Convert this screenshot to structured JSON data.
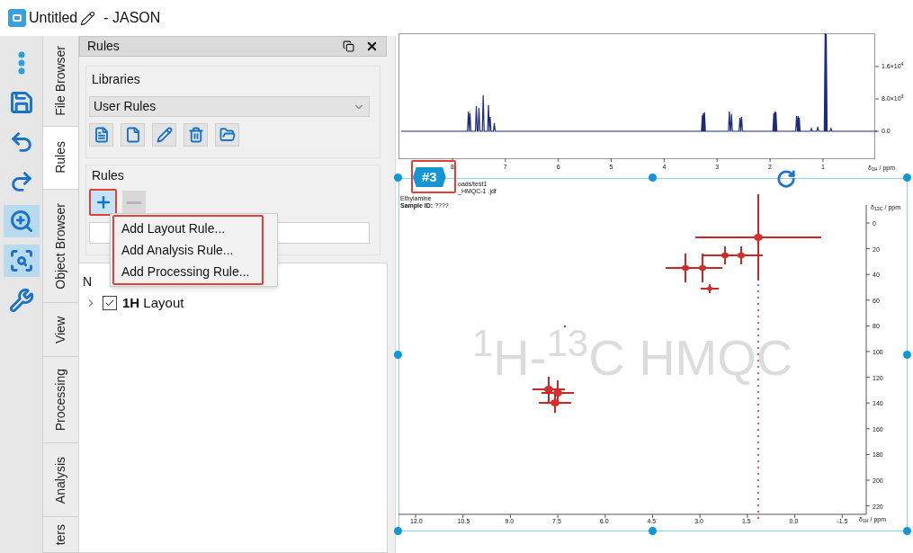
{
  "window": {
    "title": "Untitled",
    "app": "- JASON"
  },
  "toolbar": [
    {
      "kind": "more",
      "selected": false
    },
    {
      "kind": "save",
      "selected": false
    },
    {
      "kind": "undo",
      "selected": false
    },
    {
      "kind": "redo",
      "selected": false
    },
    {
      "kind": "zoom",
      "selected": true
    },
    {
      "kind": "zoom-region",
      "selected": true
    },
    {
      "kind": "tools",
      "selected": false
    }
  ],
  "side_tabs": [
    {
      "label": "File Browser",
      "selected": false
    },
    {
      "label": "Rules",
      "selected": true
    },
    {
      "label": "Object Browser",
      "selected": false
    },
    {
      "label": "View",
      "selected": false
    },
    {
      "label": "Processing",
      "selected": false
    },
    {
      "label": "Analysis",
      "selected": false
    },
    {
      "label": "ters",
      "selected": false
    }
  ],
  "panel": {
    "title": "Rules",
    "libraries": {
      "label": "Libraries",
      "value": "User Rules"
    },
    "rules": {
      "label": "Rules",
      "remove_disabled": true,
      "menu_open": true
    },
    "tree": {
      "header": "N",
      "items": [
        {
          "label": "**1H** Layout",
          "checked": true,
          "expanded": false
        }
      ]
    }
  },
  "add_menu": [
    "Add Layout Rule...",
    "Add Analysis Rule...",
    "Add Processing Rule..."
  ],
  "spectrum_1d": {
    "xlabel": "δ$_{1H}$ / ppm",
    "xticks": [
      "8",
      "7",
      "6",
      "5",
      "4",
      "3",
      "2",
      "1"
    ],
    "yticks": [
      "1.6×10$^{4}$",
      "8.0×10$^{3}$",
      "0.0"
    ]
  },
  "spectrum_2d": {
    "badge": "#3",
    "info": [
      "oads/test1",
      "_HMQC-1 .jdf",
      "Ethylamine",
      "**Sample ID:** ????"
    ],
    "title": "$^{1}$H-$^{13}$C HMQC",
    "xlabel": "δ$_{1H}$ / ppm",
    "ylabel": "δ$_{13C}$ / ppm",
    "xticks": [
      "12.0",
      "10.5",
      "9.0",
      "7.5",
      "6.0",
      "4.5",
      "3.0",
      "1.5",
      "0.0",
      "-1.5"
    ],
    "yticks": [
      "0",
      "20",
      "40",
      "60",
      "80",
      "100",
      "120",
      "140",
      "160",
      "180",
      "200",
      "220"
    ]
  }
}
